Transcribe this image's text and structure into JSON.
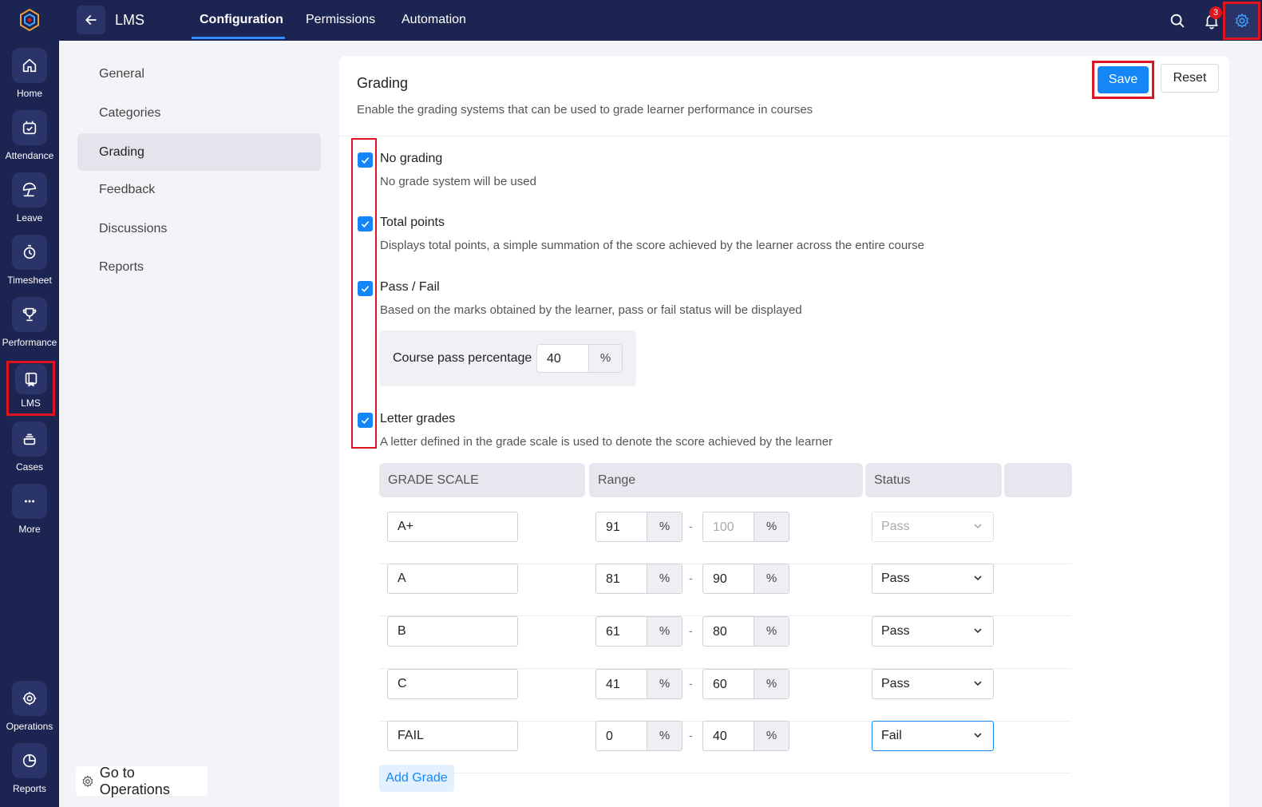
{
  "rail": {
    "items": [
      {
        "label": "Home",
        "icon": "home-icon"
      },
      {
        "label": "Attendance",
        "icon": "calendar-check-icon"
      },
      {
        "label": "Leave",
        "icon": "beach-umbrella-icon"
      },
      {
        "label": "Timesheet",
        "icon": "stopwatch-icon"
      },
      {
        "label": "Performance",
        "icon": "trophy-icon"
      },
      {
        "label": "LMS",
        "icon": "book-icon"
      },
      {
        "label": "Cases",
        "icon": "stack-icon"
      },
      {
        "label": "More",
        "icon": "more-dots-icon"
      },
      {
        "label": "Operations",
        "icon": "operations-gear-icon"
      },
      {
        "label": "Reports",
        "icon": "pie-chart-icon"
      }
    ]
  },
  "topbar": {
    "app_title": "LMS",
    "tabs": [
      {
        "label": "Configuration",
        "active": true
      },
      {
        "label": "Permissions",
        "active": false
      },
      {
        "label": "Automation",
        "active": false
      }
    ],
    "notification_count": "3"
  },
  "subnav": {
    "items": [
      {
        "label": "General"
      },
      {
        "label": "Categories"
      },
      {
        "label": "Grading",
        "active": true
      },
      {
        "label": "Feedback"
      },
      {
        "label": "Discussions"
      },
      {
        "label": "Reports"
      }
    ],
    "goto_operations": "Go to Operations"
  },
  "grading": {
    "title": "Grading",
    "description": "Enable the grading systems that can be used to grade learner performance in courses",
    "save_label": "Save",
    "reset_label": "Reset",
    "options": [
      {
        "title": "No grading",
        "desc": "No grade system will be used",
        "checked": true
      },
      {
        "title": "Total points",
        "desc": "Displays total points, a simple summation of the score achieved by the learner across the entire course",
        "checked": true
      },
      {
        "title": "Pass / Fail",
        "desc": "Based on the marks obtained by the learner, pass or fail status will be displayed",
        "checked": true
      },
      {
        "title": "Letter grades",
        "desc": "A letter defined in the grade scale is used to denote the score achieved by the learner",
        "checked": true
      }
    ],
    "pass_percentage_label": "Course pass percentage",
    "pass_percentage_value": "40",
    "percent_symbol": "%",
    "table": {
      "headers": [
        "GRADE SCALE",
        "Range",
        "Status",
        ""
      ],
      "rows": [
        {
          "grade": "A+",
          "from": "91",
          "to": "100",
          "status": "Pass"
        },
        {
          "grade": "A",
          "from": "81",
          "to": "90",
          "status": "Pass"
        },
        {
          "grade": "B",
          "from": "61",
          "to": "80",
          "status": "Pass"
        },
        {
          "grade": "C",
          "from": "41",
          "to": "60",
          "status": "Pass"
        },
        {
          "grade": "FAIL",
          "from": "0",
          "to": "40",
          "status": "Fail"
        }
      ],
      "range_separator": "-"
    },
    "add_grade_label": "Add Grade"
  },
  "colors": {
    "nav_bg": "#1c2452",
    "accent": "#1486f5",
    "highlight": "#e0141e"
  }
}
